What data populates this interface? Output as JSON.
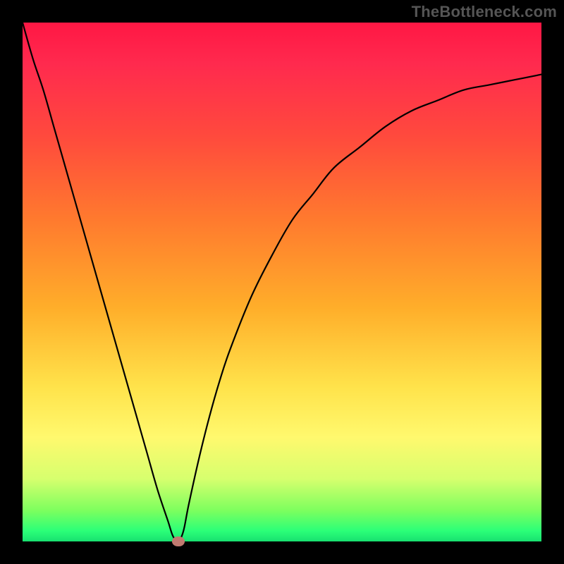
{
  "attribution": "TheBottleneck.com",
  "colors": {
    "background": "#000000",
    "gradient_top": "#ff1744",
    "gradient_bottom": "#18e070",
    "curve": "#000000",
    "marker": "#c07a70"
  },
  "chart_data": {
    "type": "line",
    "title": "",
    "xlabel": "",
    "ylabel": "",
    "xlim": [
      0,
      100
    ],
    "ylim": [
      0,
      100
    ],
    "x": [
      0,
      2,
      4,
      6,
      8,
      10,
      12,
      14,
      16,
      18,
      20,
      22,
      24,
      26,
      28,
      29,
      30,
      31,
      32,
      34,
      36,
      38,
      40,
      44,
      48,
      52,
      56,
      60,
      65,
      70,
      75,
      80,
      85,
      90,
      95,
      100
    ],
    "values": [
      100,
      93,
      87,
      80,
      73,
      66,
      59,
      52,
      45,
      38,
      31,
      24,
      17,
      10,
      4,
      1,
      0,
      2,
      7,
      16,
      24,
      31,
      37,
      47,
      55,
      62,
      67,
      72,
      76,
      80,
      83,
      85,
      87,
      88,
      89,
      90
    ],
    "marker": {
      "x": 30,
      "y": 0
    }
  }
}
